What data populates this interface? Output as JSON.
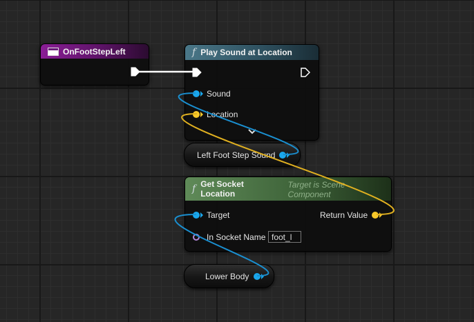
{
  "colors": {
    "exec": "#ffffff",
    "object_pin": "#1aa7ec",
    "vector_pin": "#f8c82a",
    "name_pin": "#b287d8",
    "event_header": "#8a1e96",
    "function_header": "#4a7788",
    "pure_function_header": "#5f8a58"
  },
  "event_node": {
    "title": "OnFootStepLeft",
    "icon": "event-icon"
  },
  "play_sound_node": {
    "function_symbol": "f",
    "title": "Play Sound at Location",
    "pins": {
      "sound": "Sound",
      "location": "Location"
    },
    "expand_icon": "chevron-down-icon"
  },
  "left_foot_var": {
    "label": "Left Foot Step Sound"
  },
  "get_socket_node": {
    "function_symbol": "f",
    "title": "Get Socket Location",
    "subtitle": "Target is Scene Component",
    "pins": {
      "target": "Target",
      "return_value": "Return Value",
      "socket_name": "In Socket Name",
      "socket_name_value": "foot_l"
    }
  },
  "lower_body_var": {
    "label": "Lower Body"
  }
}
